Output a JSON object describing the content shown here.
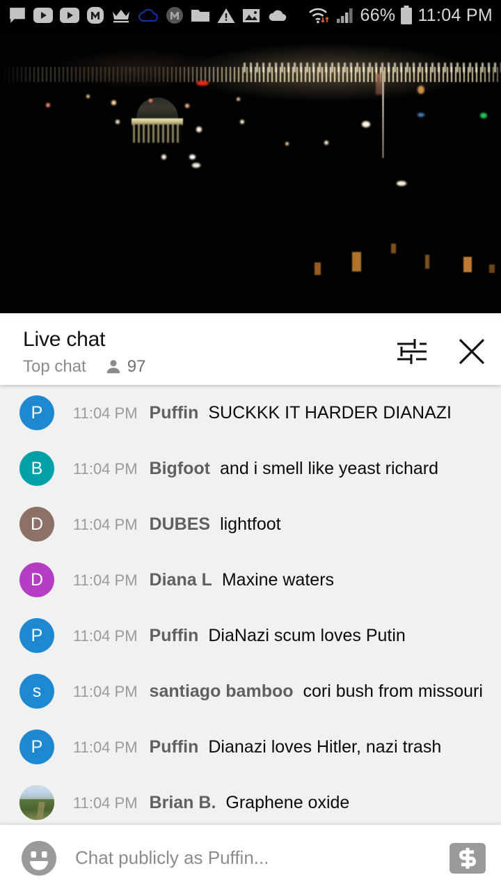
{
  "status_bar": {
    "battery_percent": "66%",
    "clock": "11:04 PM",
    "left_icons": [
      "message-bubble-icon",
      "youtube-play-icon",
      "youtube-play-icon-2",
      "m-badge-icon",
      "crown-icon",
      "cloud-outline-icon",
      "m-circle-gray-icon",
      "folder-icon",
      "warning-triangle-icon",
      "image-icon",
      "cloud-filled-icon"
    ],
    "right_icons": [
      "wifi-transfer-icon",
      "cell-signal-icon",
      "battery-icon"
    ]
  },
  "player": {
    "scene_description": "night-cityscape-video",
    "progress_color": "#e62117",
    "progress_percent": 100
  },
  "chat_header": {
    "title": "Live chat",
    "mode": "Top chat",
    "viewer_count": "97",
    "viewers_icon": "person-icon",
    "settings_icon": "tune-sliders-icon",
    "close_icon": "close-x-icon"
  },
  "messages": [
    {
      "time": "11:04 PM",
      "author": "Puffin",
      "text": "SUCKKK IT HARDER DIANAZI",
      "avatar_letter": "P",
      "avatar_color": "#1e88d0",
      "avatar_type": "letter"
    },
    {
      "time": "11:04 PM",
      "author": "Bigfoot",
      "text": "and i smell like yeast richard",
      "avatar_letter": "B",
      "avatar_color": "#00a0a8",
      "avatar_type": "letter"
    },
    {
      "time": "11:04 PM",
      "author": "DUBES",
      "text": "lightfoot",
      "avatar_letter": "D",
      "avatar_color": "#8d7168",
      "avatar_type": "letter"
    },
    {
      "time": "11:04 PM",
      "author": "Diana L",
      "text": "Maxine waters",
      "avatar_letter": "D",
      "avatar_color": "#b43dc4",
      "avatar_type": "letter"
    },
    {
      "time": "11:04 PM",
      "author": "Puffin",
      "text": "DiaNazi scum loves Putin",
      "avatar_letter": "P",
      "avatar_color": "#1e88d0",
      "avatar_type": "letter"
    },
    {
      "time": "11:04 PM",
      "author": "santiago bamboo",
      "text": "cori bush from missouri",
      "avatar_letter": "s",
      "avatar_color": "#1e88d0",
      "avatar_type": "letter"
    },
    {
      "time": "11:04 PM",
      "author": "Puffin",
      "text": "Dianazi loves Hitler, nazi trash",
      "avatar_letter": "P",
      "avatar_color": "#1e88d0",
      "avatar_type": "letter"
    },
    {
      "time": "11:04 PM",
      "author": "Brian B.",
      "text": "Graphene oxide",
      "avatar_letter": "",
      "avatar_color": "#6f8c4e",
      "avatar_type": "photo"
    }
  ],
  "input_bar": {
    "emoji_icon": "emoji-smiley-icon",
    "placeholder": "Chat publicly as Puffin...",
    "value": "",
    "superchat_icon": "dollar-sign-icon"
  }
}
